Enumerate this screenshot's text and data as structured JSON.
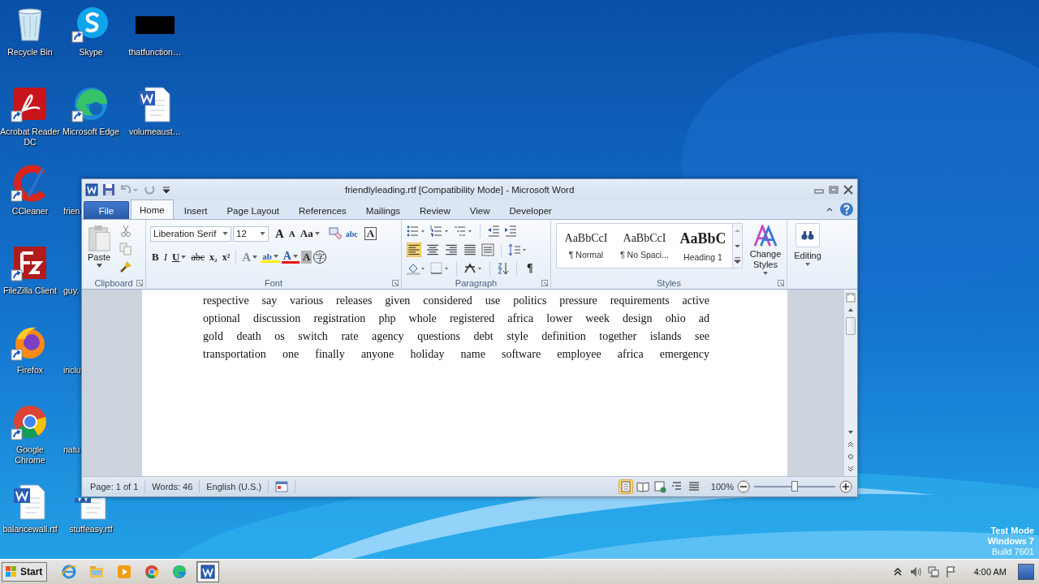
{
  "desktop_columns": [
    [
      {
        "label": "Recycle Bin",
        "kind": "recycle",
        "shortcut": false
      },
      {
        "label": "Acrobat Reader DC",
        "kind": "acrobat",
        "shortcut": true
      },
      {
        "label": "CCleaner",
        "kind": "ccleaner",
        "shortcut": true
      },
      {
        "label": "FileZilla Client",
        "kind": "filezilla",
        "shortcut": true
      },
      {
        "label": "Firefox",
        "kind": "firefox",
        "shortcut": true
      },
      {
        "label": "Google Chrome",
        "kind": "chrome",
        "shortcut": true
      },
      {
        "label": "balancewall.rtf",
        "kind": "worddoc",
        "shortcut": false
      }
    ],
    [
      {
        "label": "Skype",
        "kind": "skype",
        "shortcut": true
      },
      {
        "label": "Microsoft Edge",
        "kind": "edge",
        "shortcut": true
      },
      {
        "label": "frien",
        "kind": "partial"
      },
      {
        "label": "guy.",
        "kind": "partial"
      },
      {
        "label": "inclu",
        "kind": "partial"
      },
      {
        "label": "natu",
        "kind": "partial"
      },
      {
        "label": "stuffeasy.rtf",
        "kind": "worddoc",
        "shortcut": false
      }
    ],
    [
      {
        "label": "thatfunction…",
        "kind": "blackbox",
        "shortcut": false
      },
      {
        "label": "volumeaust…",
        "kind": "worddoc",
        "shortcut": false
      }
    ]
  ],
  "window": {
    "title": "friendlyleading.rtf [Compatibility Mode] - Microsoft Word",
    "tabs": [
      {
        "label": "File",
        "kind": "file",
        "selected": false
      },
      {
        "label": "Home",
        "kind": "tab",
        "selected": true
      },
      {
        "label": "Insert",
        "kind": "tab",
        "selected": false
      },
      {
        "label": "Page Layout",
        "kind": "tab",
        "selected": false
      },
      {
        "label": "References",
        "kind": "tab",
        "selected": false
      },
      {
        "label": "Mailings",
        "kind": "tab",
        "selected": false
      },
      {
        "label": "Review",
        "kind": "tab",
        "selected": false
      },
      {
        "label": "View",
        "kind": "tab",
        "selected": false
      },
      {
        "label": "Developer",
        "kind": "tab",
        "selected": false
      }
    ],
    "ribbon": {
      "clipboard": {
        "paste": "Paste",
        "label": "Clipboard"
      },
      "font": {
        "label": "Font",
        "name": "Liberation Serif",
        "size": "12",
        "row1": [
          {
            "glyph": "A",
            "kind": "grow"
          },
          {
            "glyph": "A",
            "kind": "shrink"
          },
          {
            "glyph": "Aa",
            "kind": "case"
          },
          {
            "kind": "clear"
          },
          {
            "glyph": "abc",
            "kind": "phonetic"
          },
          {
            "glyph": "A",
            "kind": "border"
          }
        ],
        "row2": [
          {
            "glyph": "B",
            "kind": "bold"
          },
          {
            "glyph": "I",
            "kind": "italic"
          },
          {
            "glyph": "U",
            "kind": "underline"
          },
          {
            "glyph": "abc",
            "kind": "strike"
          },
          {
            "glyph": "x₂",
            "kind": "sub"
          },
          {
            "glyph": "x²",
            "kind": "sup"
          },
          {
            "glyph": "A",
            "kind": "effects"
          },
          {
            "glyph": "ab",
            "kind": "highlight"
          },
          {
            "glyph": "A",
            "kind": "color"
          },
          {
            "glyph": "A",
            "kind": "shade"
          },
          {
            "glyph": "字",
            "kind": "enclose"
          }
        ]
      },
      "paragraph": {
        "label": "Paragraph",
        "alignment": [
          {
            "kind": "left",
            "selected": true
          },
          {
            "kind": "center",
            "selected": false
          },
          {
            "kind": "right",
            "selected": false
          },
          {
            "kind": "justify",
            "selected": false
          }
        ],
        "show_marks": {
          "glyph": "¶",
          "selected": false
        }
      },
      "styles": {
        "label": "Styles",
        "items": [
          {
            "preview": "AaBbCcI",
            "name": "¶ Normal",
            "kind": "normal"
          },
          {
            "preview": "AaBbCcI",
            "name": "¶ No Spaci...",
            "kind": "normal"
          },
          {
            "preview": "AaBbC",
            "name": "Heading 1",
            "kind": "heading"
          }
        ],
        "change": "Change Styles"
      },
      "editing": "Editing"
    },
    "document": {
      "lines": [
        "respective say various releases given considered use politics pressure requirements active",
        "optional discussion registration php whole registered africa lower week design ohio ad",
        "gold death os switch rate agency questions debt style definition together islands see",
        "transportation one finally anyone holiday name software employee africa emergency"
      ]
    },
    "status_bar": {
      "page": "Page: 1 of 1",
      "words": "Words: 46",
      "language": "English (U.S.)",
      "views": [
        {
          "kind": "print",
          "selected": true
        },
        {
          "kind": "reading",
          "selected": false
        },
        {
          "kind": "web",
          "selected": false
        },
        {
          "kind": "outline",
          "selected": false
        },
        {
          "kind": "draft",
          "selected": false
        }
      ],
      "zoom": "100%",
      "zoom_slider": {
        "level": 0.5
      }
    }
  },
  "taskbar": {
    "start": "Start",
    "apps": [
      {
        "kind": "ie",
        "selected": false
      },
      {
        "kind": "explorer",
        "selected": false
      },
      {
        "kind": "media",
        "selected": false
      },
      {
        "kind": "chrome",
        "selected": false
      },
      {
        "kind": "edge",
        "selected": false
      },
      {
        "kind": "word",
        "selected": true
      }
    ],
    "clock": "4:00 AM"
  },
  "os_notice": [
    "Test Mode",
    "Windows 7",
    "Build 7601"
  ]
}
